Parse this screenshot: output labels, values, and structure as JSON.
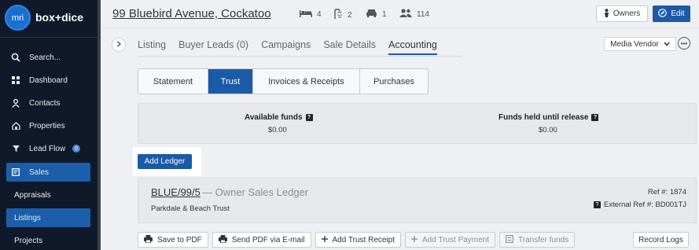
{
  "sidebar": {
    "logo_text": "mri",
    "brand": "box+dice",
    "items": [
      {
        "label": "Search...",
        "icon": "search-icon"
      },
      {
        "label": "Dashboard",
        "icon": "grid-icon"
      },
      {
        "label": "Contacts",
        "icon": "person-icon"
      },
      {
        "label": "Properties",
        "icon": "home-icon"
      },
      {
        "label": "Lead Flow",
        "icon": "filter-icon",
        "badge": "0"
      },
      {
        "label": "Sales",
        "icon": "sales-icon",
        "active": true
      },
      {
        "label": "Appraisals"
      },
      {
        "label": "Listings",
        "active": true
      },
      {
        "label": "Projects"
      }
    ]
  },
  "header": {
    "address": "99 Bluebird Avenue, Cockatoo",
    "features": [
      {
        "icon": "bed-icon",
        "value": "4"
      },
      {
        "icon": "shower-icon",
        "value": "2"
      },
      {
        "icon": "car-icon",
        "value": "1"
      },
      {
        "icon": "people-icon",
        "value": "114"
      }
    ],
    "owners_label": "Owners",
    "edit_label": "Edit"
  },
  "tabs": [
    "Listing",
    "Buyer Leads (0)",
    "Campaigns",
    "Sale Details",
    "Accounting"
  ],
  "active_tab": "Accounting",
  "vendor_select": "Media Vendor",
  "subtabs": [
    "Statement",
    "Trust",
    "Invoices & Receipts",
    "Purchases"
  ],
  "active_subtab": "Trust",
  "funds": {
    "available_label": "Available funds",
    "available_value": "$0.00",
    "held_label": "Funds held until release",
    "held_value": "$0.00"
  },
  "add_ledger_label": "Add Ledger",
  "ledger": {
    "code": "BLUE/99/5",
    "type": "— Owner Sales Ledger",
    "trust": "Parkdale & Beach Trust",
    "ref": "Ref #: 1874",
    "external_ref": "External Ref #: BD001TJ"
  },
  "actions": [
    {
      "label": "Save to PDF",
      "icon": "printer-icon"
    },
    {
      "label": "Send PDF via E-mail",
      "icon": "printer-icon"
    },
    {
      "label": "Add Trust Receipt",
      "icon": "plus-icon"
    },
    {
      "label": "Add Trust Payment",
      "icon": "plus-icon",
      "disabled": true
    },
    {
      "label": "Transfer funds",
      "icon": "transfer-icon",
      "disabled": true
    }
  ],
  "record_logs_label": "Record Logs",
  "colors": {
    "accent": "#1a5aa6",
    "sidebar_bg": "#10192a"
  }
}
